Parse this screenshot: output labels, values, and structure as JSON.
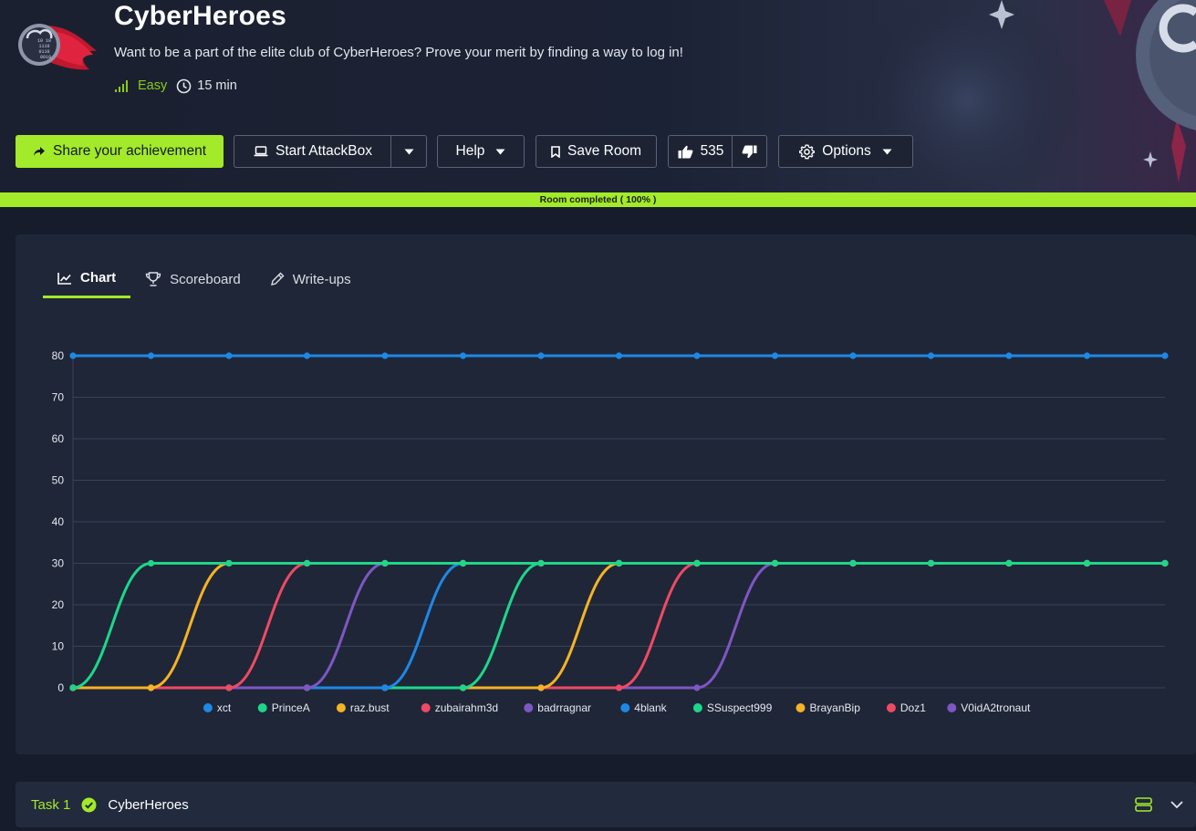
{
  "room": {
    "title": "CyberHeroes",
    "description": "Want to be a part of the elite club of CyberHeroes? Prove your merit by finding a way to log in!",
    "difficulty": "Easy",
    "duration": "15 min",
    "icon_text": [
      "10 10",
      "1110",
      "0110",
      "0010"
    ]
  },
  "toolbar": {
    "share_label": "Share your achievement",
    "attackbox_label": "Start AttackBox",
    "help_label": "Help",
    "save_label": "Save Room",
    "likes_count": "535",
    "options_label": "Options"
  },
  "progress": {
    "label": "Room completed ( 100% )",
    "percent": 100
  },
  "tabs": [
    {
      "label": "Chart",
      "icon": "line-chart-icon",
      "active": true
    },
    {
      "label": "Scoreboard",
      "icon": "trophy-icon",
      "active": false
    },
    {
      "label": "Write-ups",
      "icon": "pencil-icon",
      "active": false
    }
  ],
  "chart_data": {
    "type": "line",
    "x": [
      0,
      1,
      2,
      3,
      4,
      5,
      6,
      7,
      8,
      9,
      10,
      11,
      12,
      13,
      14
    ],
    "ylim": [
      0,
      80
    ],
    "yticks": [
      0,
      10,
      20,
      30,
      40,
      50,
      60,
      70,
      80
    ],
    "grid": true,
    "legend_position": "bottom",
    "series": [
      {
        "name": "xct",
        "color": "#1e88e5",
        "values": [
          80,
          80,
          80,
          80,
          80,
          80,
          80,
          80,
          80,
          80,
          80,
          80,
          80,
          80,
          80
        ]
      },
      {
        "name": "PrinceA",
        "color": "#1ed68a",
        "values": [
          0,
          30,
          30,
          30,
          30,
          30,
          30,
          30,
          30,
          30,
          30,
          30,
          30,
          30,
          30
        ]
      },
      {
        "name": "raz.bust",
        "color": "#f5b325",
        "values": [
          0,
          0,
          30,
          30,
          30,
          30,
          30,
          30,
          30,
          30,
          30,
          30,
          30,
          30,
          30
        ]
      },
      {
        "name": "zubairahm3d",
        "color": "#ef4a64",
        "values": [
          0,
          0,
          0,
          30,
          30,
          30,
          30,
          30,
          30,
          30,
          30,
          30,
          30,
          30,
          30
        ]
      },
      {
        "name": "badrragnar",
        "color": "#7e57c2",
        "values": [
          0,
          0,
          0,
          0,
          30,
          30,
          30,
          30,
          30,
          30,
          30,
          30,
          30,
          30,
          30
        ]
      },
      {
        "name": "4blank",
        "color": "#1e88e5",
        "values": [
          0,
          0,
          0,
          0,
          0,
          30,
          30,
          30,
          30,
          30,
          30,
          30,
          30,
          30,
          30
        ]
      },
      {
        "name": "SSuspect999",
        "color": "#1ed68a",
        "values": [
          0,
          0,
          0,
          0,
          0,
          0,
          30,
          30,
          30,
          30,
          30,
          30,
          30,
          30,
          30
        ]
      },
      {
        "name": "BrayanBip",
        "color": "#f5b325",
        "values": [
          0,
          0,
          0,
          0,
          0,
          0,
          0,
          30,
          30,
          30,
          30,
          30,
          30,
          30,
          30
        ]
      },
      {
        "name": "Doz1",
        "color": "#ef4a64",
        "values": [
          0,
          0,
          0,
          0,
          0,
          0,
          0,
          0,
          30,
          30,
          30,
          30,
          30,
          30,
          30
        ]
      },
      {
        "name": "V0idA2tronaut",
        "color": "#7e57c2",
        "values": [
          0,
          0,
          0,
          0,
          0,
          0,
          0,
          0,
          0,
          30,
          30,
          30,
          30,
          30,
          30
        ]
      }
    ]
  },
  "task": {
    "number_label": "Task 1",
    "title": "CyberHeroes"
  },
  "colors": {
    "accent": "#a3ea2a",
    "background": "#161c2b",
    "card": "#1f2638"
  }
}
